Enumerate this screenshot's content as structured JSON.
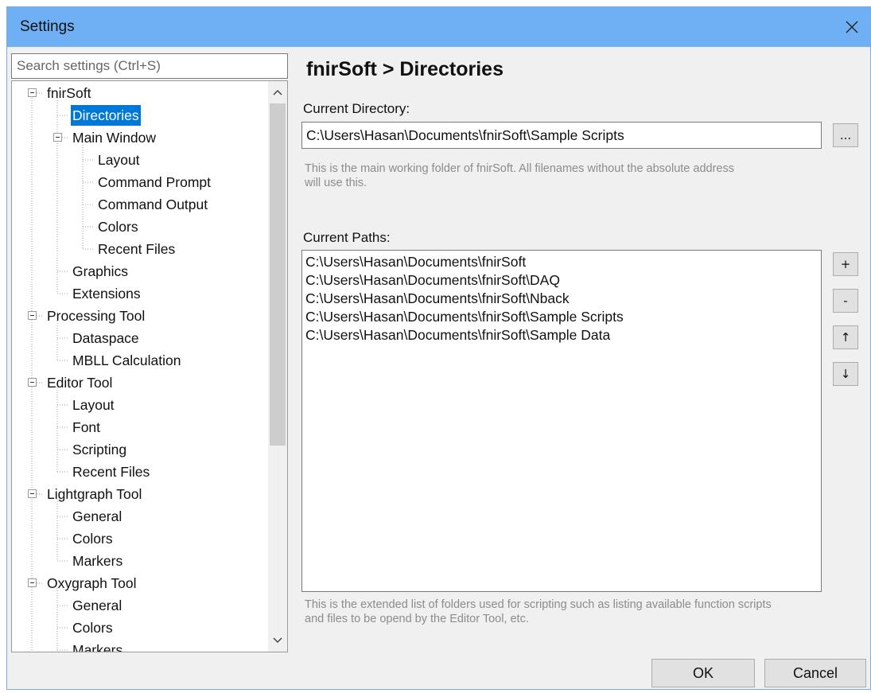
{
  "window": {
    "title": "Settings"
  },
  "search": {
    "placeholder": "Search settings (Ctrl+S)"
  },
  "tree": {
    "items": [
      {
        "label": "fnirSoft",
        "level": 0,
        "expander": true
      },
      {
        "label": "Directories",
        "level": 1,
        "selected": true
      },
      {
        "label": "Main Window",
        "level": 1,
        "expander": true
      },
      {
        "label": "Layout",
        "level": 2
      },
      {
        "label": "Command Prompt",
        "level": 2
      },
      {
        "label": "Command Output",
        "level": 2
      },
      {
        "label": "Colors",
        "level": 2
      },
      {
        "label": "Recent Files",
        "level": 2
      },
      {
        "label": "Graphics",
        "level": 1
      },
      {
        "label": "Extensions",
        "level": 1
      },
      {
        "label": "Processing Tool",
        "level": 0,
        "expander": true
      },
      {
        "label": "Dataspace",
        "level": 1
      },
      {
        "label": "MBLL Calculation",
        "level": 1
      },
      {
        "label": "Editor Tool",
        "level": 0,
        "expander": true
      },
      {
        "label": "Layout",
        "level": 1
      },
      {
        "label": "Font",
        "level": 1
      },
      {
        "label": "Scripting",
        "level": 1
      },
      {
        "label": "Recent Files",
        "level": 1
      },
      {
        "label": "Lightgraph Tool",
        "level": 0,
        "expander": true
      },
      {
        "label": "General",
        "level": 1
      },
      {
        "label": "Colors",
        "level": 1
      },
      {
        "label": "Markers",
        "level": 1
      },
      {
        "label": "Oxygraph Tool",
        "level": 0,
        "expander": true
      },
      {
        "label": "General",
        "level": 1
      },
      {
        "label": "Colors",
        "level": 1
      },
      {
        "label": "Markers",
        "level": 1
      }
    ]
  },
  "page": {
    "title": "fnirSoft > Directories",
    "current_directory": {
      "label": "Current Directory:",
      "value": "C:\\Users\\Hasan\\Documents\\fnirSoft\\Sample Scripts",
      "browse_label": "...",
      "hint": "This is the main working folder of fnirSoft. All filenames without the absolute address will use this."
    },
    "current_paths": {
      "label": "Current Paths:",
      "items": [
        "C:\\Users\\Hasan\\Documents\\fnirSoft",
        "C:\\Users\\Hasan\\Documents\\fnirSoft\\DAQ",
        "C:\\Users\\Hasan\\Documents\\fnirSoft\\Nback",
        "C:\\Users\\Hasan\\Documents\\fnirSoft\\Sample Scripts",
        "C:\\Users\\Hasan\\Documents\\fnirSoft\\Sample Data"
      ],
      "add_label": "+",
      "remove_label": "-",
      "up_label": "↑",
      "down_label": "↓",
      "hint": "This is the extended list of folders used for scripting such as listing available function scripts and files to be opend by the Editor Tool, etc."
    }
  },
  "buttons": {
    "ok": "OK",
    "cancel": "Cancel"
  },
  "colors": {
    "titlebar": "#6fb0f5",
    "selection": "#0078d7"
  },
  "icons": {
    "close": "close-icon",
    "scroll_up": "chevron-up-icon",
    "scroll_down": "chevron-down-icon"
  }
}
